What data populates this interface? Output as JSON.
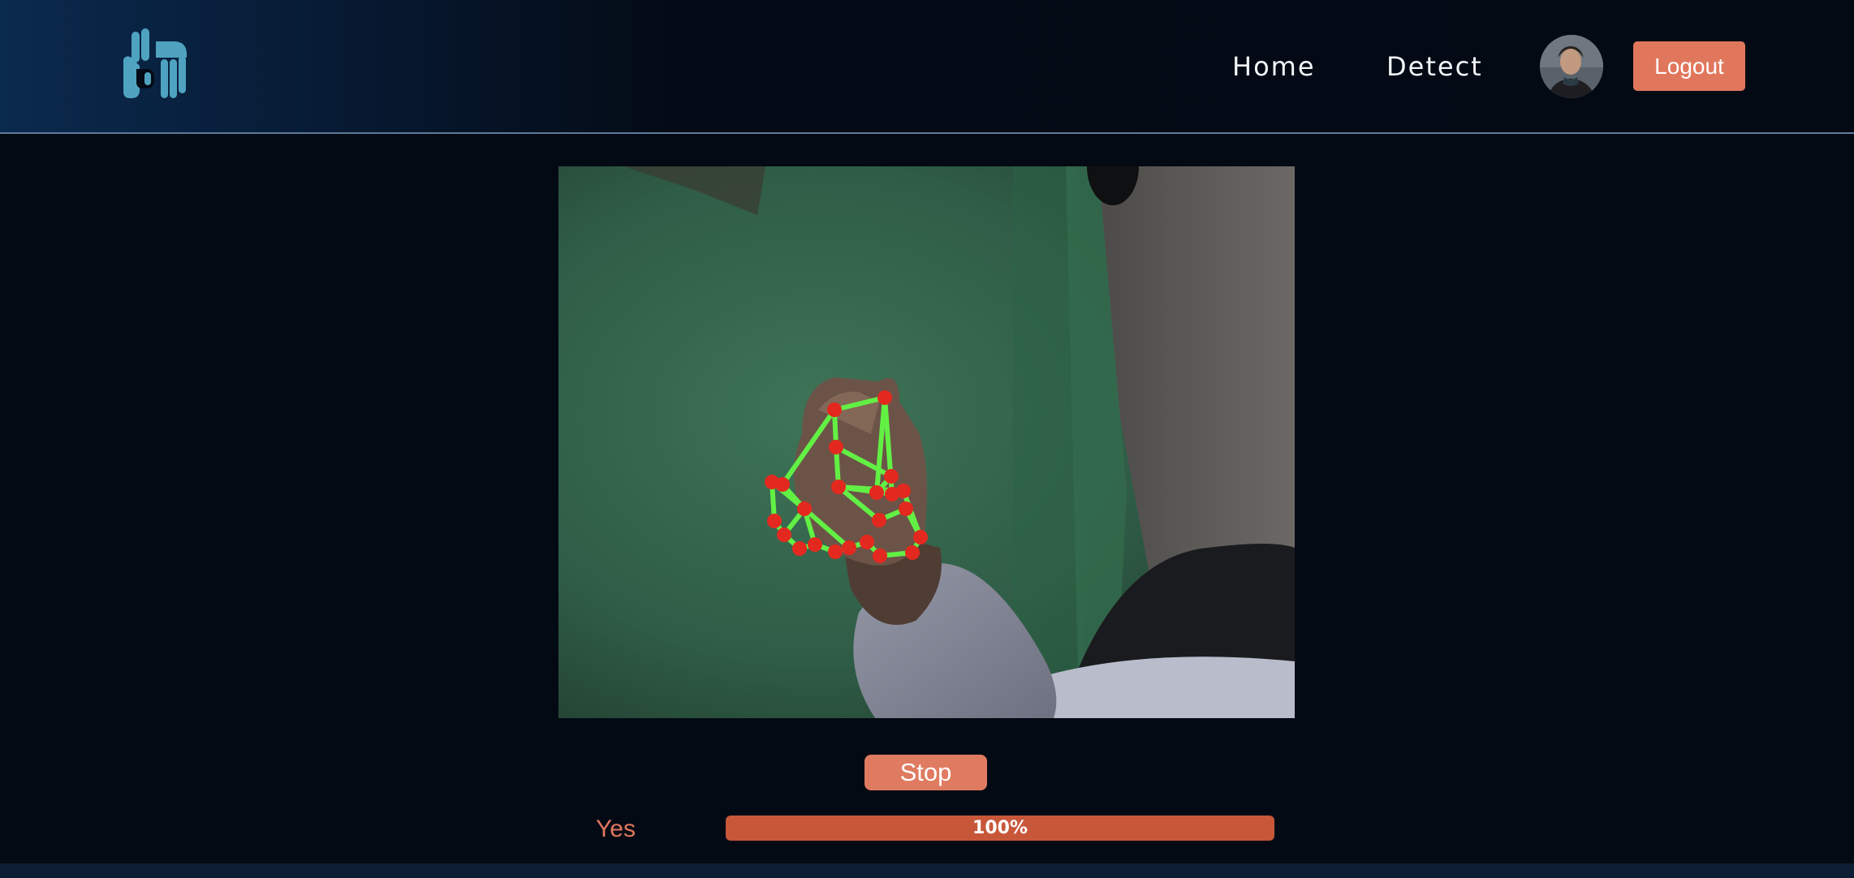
{
  "nav": {
    "home_label": "Home",
    "detect_label": "Detect",
    "logout_label": "Logout",
    "logo_icon": "hands-logo-icon",
    "avatar_icon": "user-avatar"
  },
  "camera": {
    "overlay_colors": {
      "landmark": "#e3291f",
      "connection": "#62f044"
    }
  },
  "controls": {
    "stop_label": "Stop"
  },
  "result": {
    "label": "Yes",
    "confidence_text": "100%",
    "confidence": 1.0
  },
  "colors": {
    "accent": "#e0775c",
    "progress": "#c8573a",
    "background": "#040a14",
    "logo": "#4fa3c0"
  }
}
